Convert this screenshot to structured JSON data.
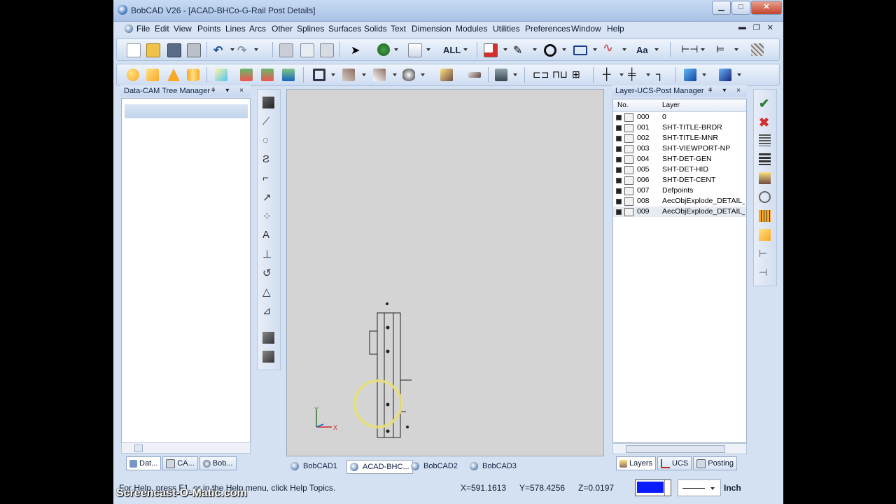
{
  "window": {
    "title": "BobCAD V26 - [ACAD-BHCo-G-Rail Post Details]"
  },
  "menu": [
    "File",
    "Edit",
    "View",
    "Points",
    "Lines",
    "Arcs",
    "Other",
    "Splines",
    "Surfaces",
    "Solids",
    "Text",
    "Dimension",
    "Modules",
    "Utilities",
    "Preferences",
    "Window",
    "Help"
  ],
  "toolbar": {
    "filter_label": "ALL",
    "text_label": "Aa"
  },
  "left_panel": {
    "title": "Data-CAM Tree Manager",
    "tabs": [
      "Dat...",
      "CA...",
      "Bob..."
    ]
  },
  "right_panel": {
    "title": "Layer-UCS-Post Manager",
    "columns": [
      "No.",
      "Layer"
    ],
    "layers": [
      {
        "no": "000",
        "name": "0"
      },
      {
        "no": "001",
        "name": "SHT-TITLE-BRDR"
      },
      {
        "no": "002",
        "name": "SHT-TITLE-MNR"
      },
      {
        "no": "003",
        "name": "SHT-VIEWPORT-NP"
      },
      {
        "no": "004",
        "name": "SHT-DET-GEN"
      },
      {
        "no": "005",
        "name": "SHT-DET-HID"
      },
      {
        "no": "006",
        "name": "SHT-DET-CENT"
      },
      {
        "no": "007",
        "name": "Defpoints"
      },
      {
        "no": "008",
        "name": "AecObjExplode_DETAIL_F"
      },
      {
        "no": "009",
        "name": "AecObjExplode_DETAIL_V"
      }
    ],
    "tabs": [
      "Layers",
      "UCS",
      "Posting"
    ]
  },
  "canvas": {
    "axis_x": "X",
    "axis_y": "Y"
  },
  "doc_tabs": [
    "BobCAD1",
    "ACAD-BHC...",
    "BobCAD2",
    "BobCAD3"
  ],
  "status": {
    "help": "For Help, press F1, or in the Help menu, click Help Topics.",
    "x": "X=591.1613",
    "y": "Y=578.4256",
    "z": "Z=0.0197",
    "units": "Inch",
    "color": "#0a1cff"
  },
  "watermark": "Screencast-O-Matic.com"
}
